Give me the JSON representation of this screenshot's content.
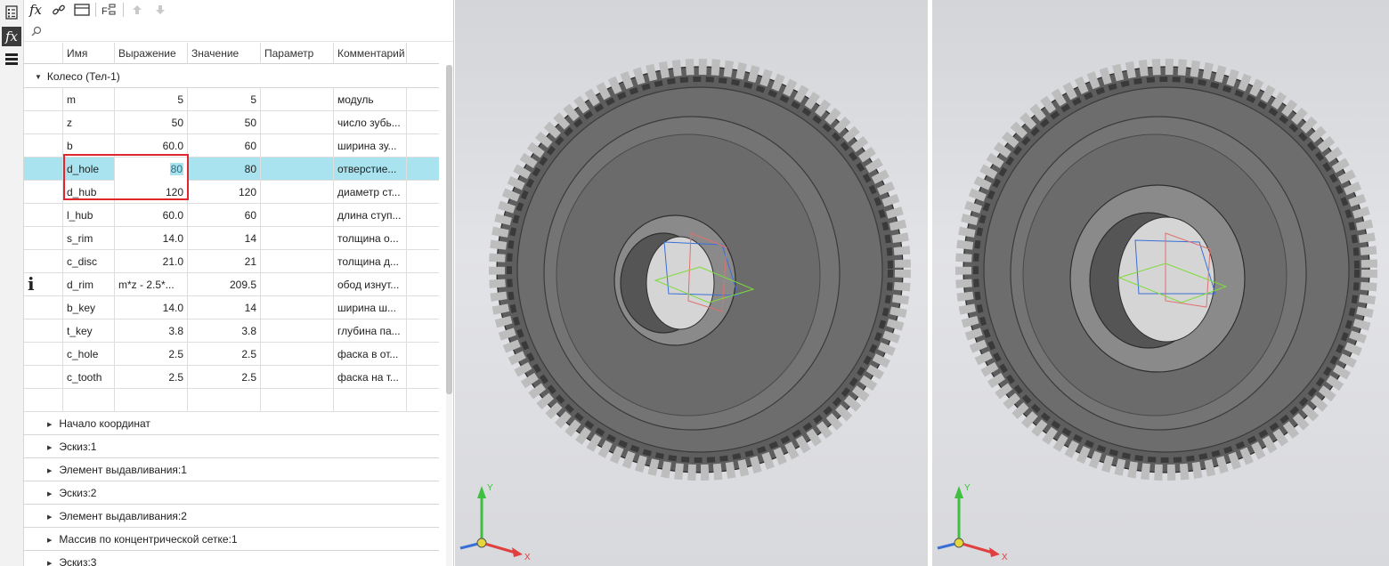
{
  "toolbar": {
    "icons": [
      "fx-icon",
      "link-icon",
      "table-icon",
      "extract-variables-icon",
      "arrow-up-icon",
      "arrow-down-icon"
    ],
    "fx_label": "fx",
    "extract_label": "F"
  },
  "left_strip": {
    "items": [
      "checklist-icon",
      "fx-icon",
      "menu-icon"
    ],
    "fx_label": "fx"
  },
  "search": {
    "placeholder": "",
    "value": ""
  },
  "columns": [
    "Имя",
    "Выражение",
    "Значение",
    "Параметр",
    "Комментарий"
  ],
  "group": {
    "label": "Колесо (Тел-1)"
  },
  "rows": [
    {
      "name": "m",
      "expression": "5",
      "value": "5",
      "parameter": "",
      "comment": "модуль"
    },
    {
      "name": "z",
      "expression": "50",
      "value": "50",
      "parameter": "",
      "comment": "число зубь..."
    },
    {
      "name": "b",
      "expression": "60.0",
      "value": "60",
      "parameter": "",
      "comment": "ширина зу..."
    },
    {
      "name": "d_hole",
      "expression": "80",
      "value": "80",
      "parameter": "",
      "comment": "отверстие..."
    },
    {
      "name": "d_hub",
      "expression": "120",
      "value": "120",
      "parameter": "",
      "comment": "диаметр ст..."
    },
    {
      "name": "l_hub",
      "expression": "60.0",
      "value": "60",
      "parameter": "",
      "comment": "длина ступ..."
    },
    {
      "name": "s_rim",
      "expression": "14.0",
      "value": "14",
      "parameter": "",
      "comment": "толщина о..."
    },
    {
      "name": "c_disc",
      "expression": "21.0",
      "value": "21",
      "parameter": "",
      "comment": "толщина д..."
    },
    {
      "name": "d_rim",
      "expression": "m*z - 2.5*...",
      "value": "209.5",
      "parameter": "",
      "comment": "обод изнут...",
      "marker": "i"
    },
    {
      "name": "b_key",
      "expression": "14.0",
      "value": "14",
      "parameter": "",
      "comment": "ширина ш..."
    },
    {
      "name": "t_key",
      "expression": "3.8",
      "value": "3.8",
      "parameter": "",
      "comment": "глубина па..."
    },
    {
      "name": "c_hole",
      "expression": "2.5",
      "value": "2.5",
      "parameter": "",
      "comment": "фаска в от..."
    },
    {
      "name": "c_tooth",
      "expression": "2.5",
      "value": "2.5",
      "parameter": "",
      "comment": "фаска на т..."
    }
  ],
  "tree_items": [
    "Начало координат",
    "Эскиз:1",
    "Элемент выдавливания:1",
    "Эскиз:2",
    "Элемент выдавливания:2",
    "Массив по концентрической сетке:1",
    "Эскиз:3"
  ],
  "axis_labels": {
    "x": "X",
    "y": "Y"
  },
  "colors": {
    "selection": "#a9e3ef",
    "highlight_border": "#e0262e",
    "gear_face": "#6f6f6f",
    "axis_x": "#e04040",
    "axis_y": "#3fbf3f",
    "axis_z": "#3a6fd8"
  },
  "viewports": [
    {
      "id": "left",
      "hub_hole": "small"
    },
    {
      "id": "right",
      "hub_hole": "large"
    }
  ]
}
